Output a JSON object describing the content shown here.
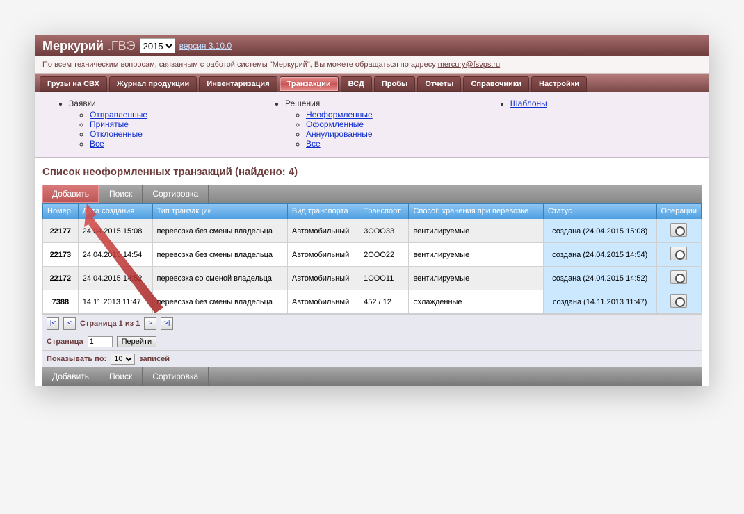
{
  "header": {
    "app_name": "Меркурий",
    "app_sub": ".ГВЭ",
    "year_selected": "2015",
    "version_label": "версия 3.10.0"
  },
  "infobar": {
    "text_prefix": "По всем техническим вопросам, связанным с работой системы \"Меркурий\", Вы можете обращаться по адресу ",
    "email": "mercury@fsvps.ru"
  },
  "tabs": [
    "Грузы на СВХ",
    "Журнал продукции",
    "Инвентаризация",
    "Транзакции",
    "ВСД",
    "Пробы",
    "Отчеты",
    "Справочники",
    "Настройки"
  ],
  "active_tab_index": 3,
  "submenu": {
    "col1_title": "Заявки",
    "col1_items": [
      "Отправленные",
      "Принятые",
      "Отклоненные",
      "Все"
    ],
    "col2_title": "Решения",
    "col2_items": [
      "Неоформленные",
      "Оформленные",
      "Аннулированные",
      "Все"
    ],
    "col3_link": "Шаблоны"
  },
  "page_title": "Список неоформленных транзакций (найдено: 4)",
  "toolbar": {
    "add": "Добавить",
    "search": "Поиск",
    "sort": "Сортировка"
  },
  "table": {
    "headers": [
      "Номер",
      "Дата создания",
      "Тип транзакции",
      "Вид транспорта",
      "Транспорт",
      "Способ хранения при перевозке",
      "Статус",
      "Операции"
    ],
    "rows": [
      {
        "num": "22177",
        "date": "24.04.2015 15:08",
        "type": "перевозка без смены владельца",
        "transport_kind": "Автомобильный",
        "transport": "3ООО33",
        "storage": "вентилируемые",
        "status": "создана (24.04.2015 15:08)"
      },
      {
        "num": "22173",
        "date": "24.04.2015 14:54",
        "type": "перевозка без смены владельца",
        "transport_kind": "Автомобильный",
        "transport": "2ООО22",
        "storage": "вентилируемые",
        "status": "создана (24.04.2015 14:54)"
      },
      {
        "num": "22172",
        "date": "24.04.2015 14:52",
        "type": "перевозка со сменой владельца",
        "transport_kind": "Автомобильный",
        "transport": "1ООО11",
        "storage": "вентилируемые",
        "status": "создана (24.04.2015 14:52)"
      },
      {
        "num": "7388",
        "date": "14.11.2013 11:47",
        "type": "перевозка без смены владельца",
        "transport_kind": "Автомобильный",
        "transport": "452 / 12",
        "storage": "охлажденные",
        "status": "создана (14.11.2013 11:47)"
      }
    ]
  },
  "pager": {
    "page_text": "Страница 1 из 1",
    "page_label": "Страница",
    "page_value": "1",
    "go_label": "Перейти",
    "per_page_label_prefix": "Показывать по:",
    "per_page_value": "10",
    "per_page_label_suffix": "записей"
  },
  "footer_toolbar": {
    "add": "Добавить",
    "search": "Поиск",
    "sort": "Сортировка"
  }
}
